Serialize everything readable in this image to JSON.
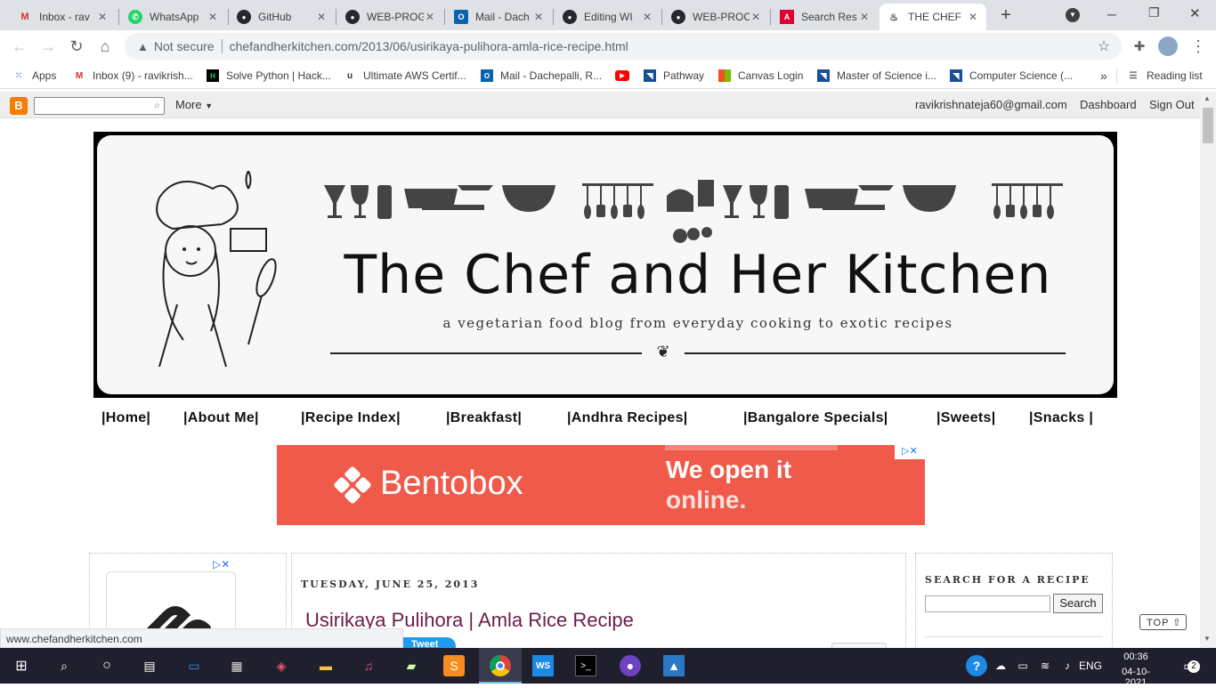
{
  "browser": {
    "tabs": [
      {
        "title": "Inbox - rav",
        "icon": "gmail-icon",
        "color": "#d93025"
      },
      {
        "title": "WhatsApp",
        "icon": "whatsapp-icon",
        "color": "#25d366"
      },
      {
        "title": "GitHub",
        "icon": "github-icon",
        "color": "#24292e"
      },
      {
        "title": "WEB-PROG",
        "icon": "github-icon",
        "color": "#24292e"
      },
      {
        "title": "Mail - Dach",
        "icon": "outlook-icon",
        "color": "#0a64ad"
      },
      {
        "title": "Editing WI",
        "icon": "github-icon",
        "color": "#24292e"
      },
      {
        "title": "WEB-PROC",
        "icon": "github-icon",
        "color": "#24292e"
      },
      {
        "title": "Search Res",
        "icon": "angular-icon",
        "color": "#dd0031"
      },
      {
        "title": "THE CHEF",
        "icon": "chef-icon",
        "color": "#444444"
      }
    ],
    "not_secure": "Not secure",
    "url": "chefandherkitchen.com/2013/06/usirikaya-pulihora-amla-rice-recipe.html",
    "bookmarks": [
      {
        "label": "Apps",
        "icon": "apps-grid-icon"
      },
      {
        "label": "Inbox (9) - ravikrish...",
        "icon": "gmail-icon"
      },
      {
        "label": "Solve Python | Hack...",
        "icon": "hackerrank-icon"
      },
      {
        "label": "Ultimate AWS Certif...",
        "icon": "udemy-icon"
      },
      {
        "label": "Mail - Dachepalli, R...",
        "icon": "outlook-icon"
      },
      {
        "label": "",
        "icon": "youtube-icon"
      },
      {
        "label": "Pathway",
        "icon": "pathway-icon"
      },
      {
        "label": "Canvas Login",
        "icon": "canvas-icon"
      },
      {
        "label": "Master of Science i...",
        "icon": "university-icon"
      },
      {
        "label": "Computer Science (...",
        "icon": "university-icon"
      }
    ],
    "more_bookmarks": "»",
    "reading_list": "Reading list",
    "status_url": "www.chefandherkitchen.com"
  },
  "blogger_navbar": {
    "more": "More",
    "email": "ravikrishnateja60@gmail.com",
    "dashboard": "Dashboard",
    "signout": "Sign Out"
  },
  "header": {
    "title": "The Chef and Her Kitchen",
    "subtitle": "a vegetarian food blog from everyday cooking to exotic recipes"
  },
  "menu": [
    "|Home|",
    "|About Me|",
    "|Recipe Index|",
    "|Breakfast|",
    "|Andhra Recipes|",
    "|Bangalore Specials|",
    "|Sweets|",
    "|Snacks |"
  ],
  "ad": {
    "brand": "Bentobox",
    "tagline1": "We open it",
    "tagline2": "online."
  },
  "post": {
    "date": "TUESDAY, JUNE 25, 2013",
    "title": "Usirikaya Pulihora | Amla Rice Recipe",
    "tweet": "Tweet"
  },
  "sidebar": {
    "search_heading": "SEARCH FOR A RECIPE",
    "search_button": "Search",
    "top_button": "TOP"
  },
  "taskbar": {
    "lang": "ENG",
    "time": "00:36",
    "date": "04-10-2021",
    "notifications": "2"
  }
}
